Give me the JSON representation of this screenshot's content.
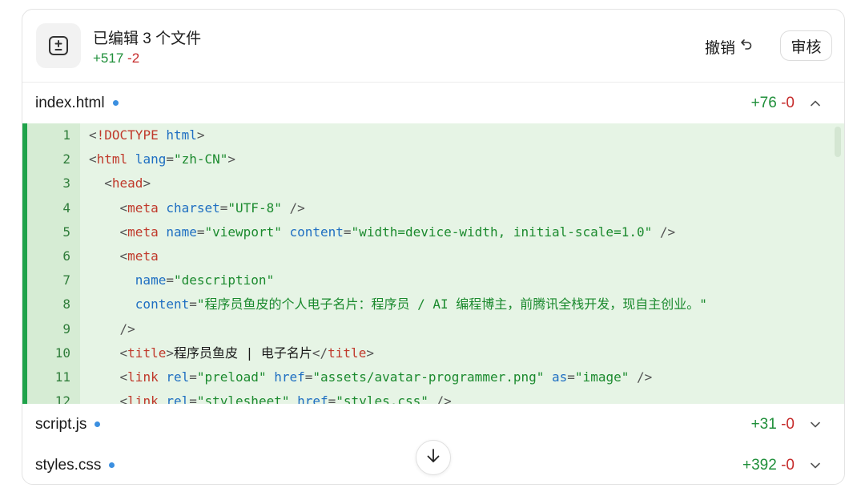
{
  "header": {
    "title": "已编辑 3 个文件",
    "added": "+517",
    "removed": "-2",
    "undo_label": "撤销",
    "review_label": "审核"
  },
  "files": [
    {
      "name": "index.html",
      "added": "+76",
      "removed": "-0",
      "expanded": true
    },
    {
      "name": "script.js",
      "added": "+31",
      "removed": "-0",
      "expanded": false
    },
    {
      "name": "styles.css",
      "added": "+392",
      "removed": "-0",
      "expanded": false
    }
  ],
  "code_lines": [
    {
      "n": "1",
      "parts": [
        [
          "p",
          "<"
        ],
        [
          "t",
          "!DOCTYPE"
        ],
        [
          "a",
          " html"
        ],
        [
          "p",
          ">"
        ]
      ]
    },
    {
      "n": "2",
      "parts": [
        [
          "p",
          "<"
        ],
        [
          "t",
          "html"
        ],
        [
          "a",
          " lang"
        ],
        [
          "p",
          "="
        ],
        [
          "s",
          "\"zh-CN\""
        ],
        [
          "p",
          ">"
        ]
      ]
    },
    {
      "n": "3",
      "parts": [
        [
          "p",
          "  <"
        ],
        [
          "t",
          "head"
        ],
        [
          "p",
          ">"
        ]
      ]
    },
    {
      "n": "4",
      "parts": [
        [
          "p",
          "    <"
        ],
        [
          "t",
          "meta"
        ],
        [
          "a",
          " charset"
        ],
        [
          "p",
          "="
        ],
        [
          "s",
          "\"UTF-8\""
        ],
        [
          "p",
          " />"
        ]
      ]
    },
    {
      "n": "5",
      "parts": [
        [
          "p",
          "    <"
        ],
        [
          "t",
          "meta"
        ],
        [
          "a",
          " name"
        ],
        [
          "p",
          "="
        ],
        [
          "s",
          "\"viewport\""
        ],
        [
          "a",
          " content"
        ],
        [
          "p",
          "="
        ],
        [
          "s",
          "\"width=device-width, initial-scale=1.0\""
        ],
        [
          "p",
          " />"
        ]
      ]
    },
    {
      "n": "6",
      "parts": [
        [
          "p",
          "    <"
        ],
        [
          "t",
          "meta"
        ]
      ]
    },
    {
      "n": "7",
      "parts": [
        [
          "a",
          "      name"
        ],
        [
          "p",
          "="
        ],
        [
          "s",
          "\"description\""
        ]
      ]
    },
    {
      "n": "8",
      "parts": [
        [
          "a",
          "      content"
        ],
        [
          "p",
          "="
        ],
        [
          "s",
          "\"程序员鱼皮的个人电子名片：程序员 / AI 编程博主，前腾讯全栈开发，现自主创业。\""
        ]
      ]
    },
    {
      "n": "9",
      "parts": [
        [
          "p",
          "    />"
        ]
      ]
    },
    {
      "n": "10",
      "parts": [
        [
          "p",
          "    <"
        ],
        [
          "t",
          "title"
        ],
        [
          "p",
          ">"
        ],
        [
          "x",
          "程序员鱼皮 | 电子名片"
        ],
        [
          "p",
          "</"
        ],
        [
          "t",
          "title"
        ],
        [
          "p",
          ">"
        ]
      ]
    },
    {
      "n": "11",
      "parts": [
        [
          "p",
          "    <"
        ],
        [
          "t",
          "link"
        ],
        [
          "a",
          " rel"
        ],
        [
          "p",
          "="
        ],
        [
          "s",
          "\"preload\""
        ],
        [
          "a",
          " href"
        ],
        [
          "p",
          "="
        ],
        [
          "s",
          "\"assets/avatar-programmer.png\""
        ],
        [
          "a",
          " as"
        ],
        [
          "p",
          "="
        ],
        [
          "s",
          "\"image\""
        ],
        [
          "p",
          " />"
        ]
      ]
    },
    {
      "n": "12",
      "parts": [
        [
          "p",
          "    <"
        ],
        [
          "t",
          "link"
        ],
        [
          "a",
          " rel"
        ],
        [
          "p",
          "="
        ],
        [
          "s",
          "\"stylesheet\""
        ],
        [
          "a",
          " href"
        ],
        [
          "p",
          "="
        ],
        [
          "s",
          "\"styles.css\""
        ],
        [
          "p",
          " />"
        ]
      ]
    }
  ],
  "colors": {
    "added": "#1f8f3a",
    "removed": "#c62b2b",
    "diff_bg": "#e6f4e5",
    "diff_bar": "#1fa34a",
    "modified_dot": "#3b8fe0"
  },
  "icons": {
    "header": "diff-icon",
    "undo": "undo-icon",
    "expand": "chevron-up-icon",
    "collapse": "chevron-down-icon",
    "scroll": "arrow-down-icon"
  }
}
